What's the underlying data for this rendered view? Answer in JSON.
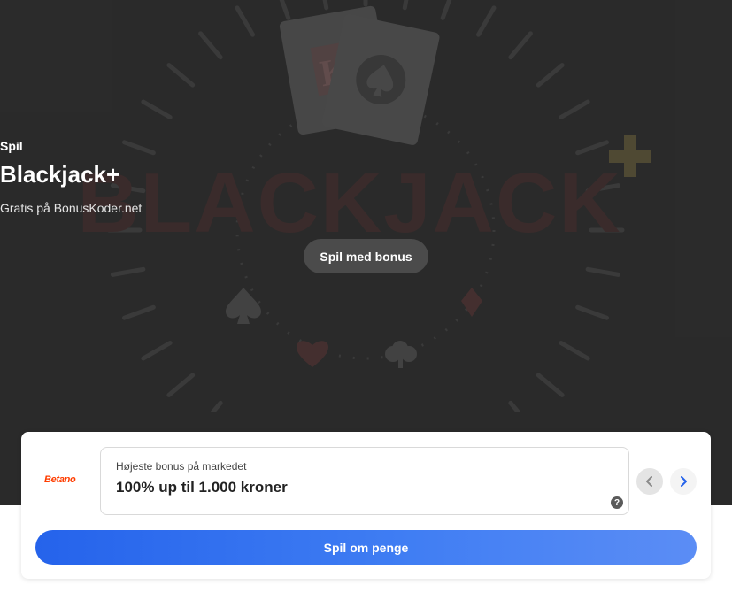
{
  "hero": {
    "eyebrow": "Spil",
    "title": "Blackjack+",
    "subtitle": "Gratis på BonusKoder.net",
    "play_bonus_label": "Spil med bonus",
    "background_word": "BLACKJACK"
  },
  "offer": {
    "brand_logo_text": "Betano",
    "label": "Højeste bonus på markedet",
    "value": "100% up til 1.000 kroner",
    "help_glyph": "?",
    "prev_icon": "chevron-left-icon",
    "next_icon": "chevron-right-icon",
    "cta_label": "Spil om penge"
  },
  "colors": {
    "hero_bg": "#323232",
    "cta_gradient_start": "#2563eb",
    "cta_gradient_end": "#5b8df5",
    "brand": "#ff3d00"
  }
}
